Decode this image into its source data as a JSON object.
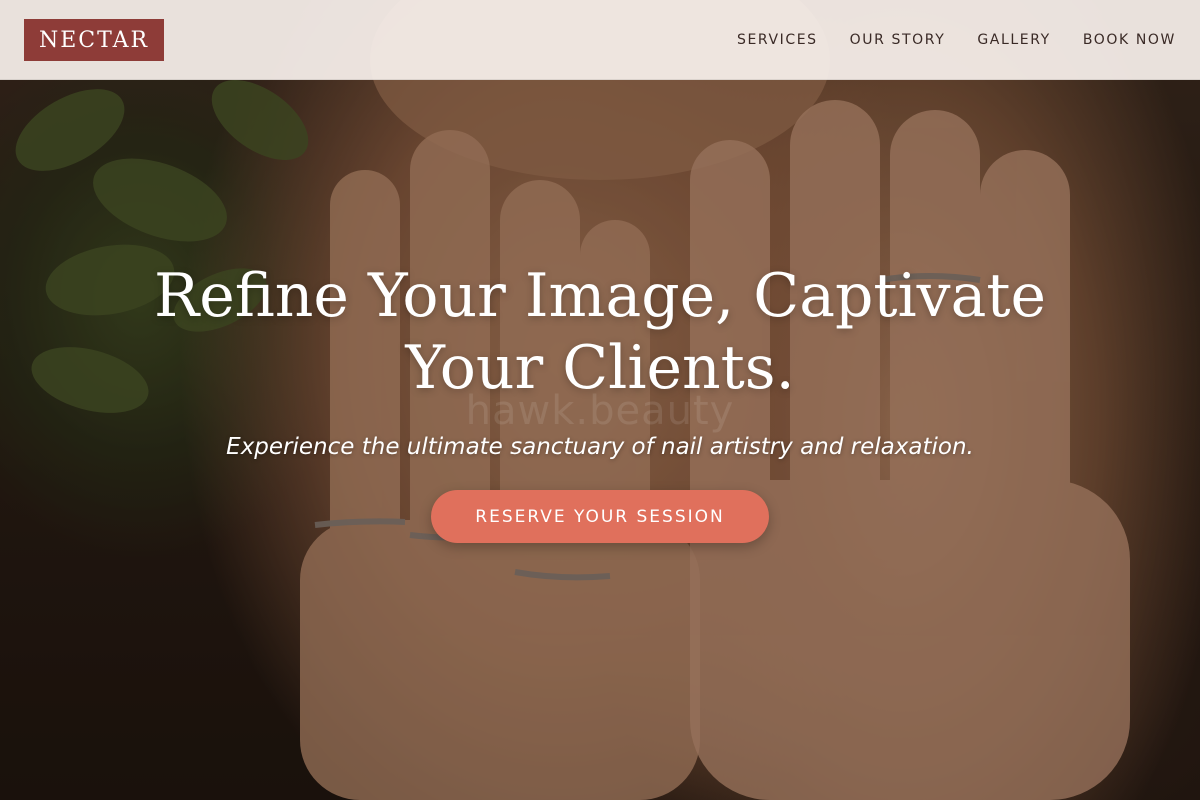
{
  "brand": {
    "logo_text": "NECTAR",
    "logo_color": "#8e3c38"
  },
  "nav": {
    "items": [
      {
        "label": "SERVICES"
      },
      {
        "label": "OUR STORY"
      },
      {
        "label": "GALLERY"
      },
      {
        "label": "BOOK NOW"
      }
    ]
  },
  "hero": {
    "title_line1": "Refine Your Image, Captivate",
    "title_line2": "Your Clients.",
    "subtitle": "Experience the ultimate sanctuary of nail artistry and relaxation.",
    "cta_label": "RESERVE YOUR SESSION",
    "cta_color": "#e0705c",
    "watermark": "hawk.beauty",
    "background_image": "hands-covering-face-with-rings-and-leaves"
  }
}
